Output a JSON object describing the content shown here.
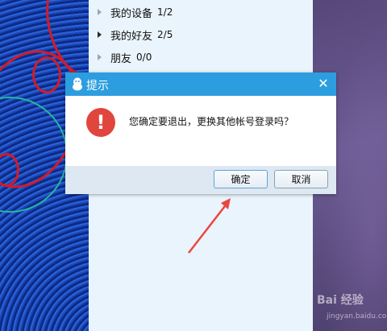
{
  "contacts": {
    "groups": [
      {
        "name": "我的设备",
        "count": "1/2"
      },
      {
        "name": "我的好友",
        "count": "2/5"
      },
      {
        "name": "朋友",
        "count": "0/0"
      }
    ]
  },
  "dialog": {
    "title": "提示",
    "close_glyph": "✕",
    "warning_glyph": "!",
    "message": "您确定要退出，更换其他帐号登录吗？",
    "ok_label": "确定",
    "cancel_label": "取消"
  },
  "watermark": {
    "text": "Bai 经验",
    "url": "jingyan.baidu.com"
  },
  "colors": {
    "titlebar": "#2c9ee0",
    "warning": "#e0463e",
    "arrow": "#e8483f"
  }
}
